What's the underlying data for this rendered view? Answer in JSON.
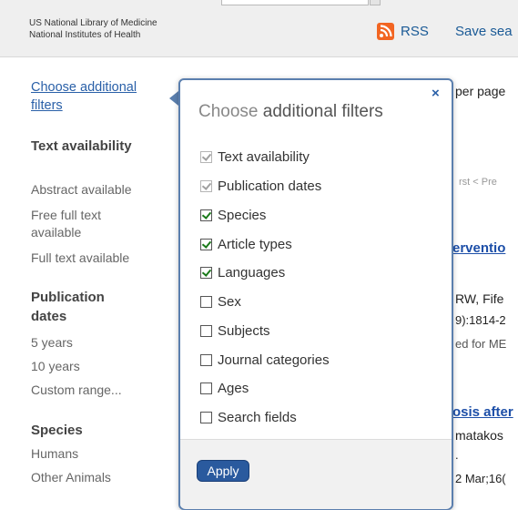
{
  "header": {
    "org_line1": "US National Library of Medicine",
    "org_line2": "National Institutes of Health",
    "rss_label": "RSS",
    "save_label": "Save sea"
  },
  "sidebar": {
    "choose_filters": "Choose additional filters",
    "facets": [
      {
        "title": "Text availability",
        "items": [
          "Abstract available",
          "Free full text available",
          "Full text available"
        ]
      },
      {
        "title": "Publication dates",
        "items": [
          "5 years",
          "10 years",
          "Custom range..."
        ]
      },
      {
        "title": "Species",
        "items": [
          "Humans",
          "Other Animals"
        ]
      }
    ]
  },
  "background": {
    "per_page": "per page",
    "pager": "rst   < Pre",
    "result1_title": "erventio",
    "result1_authors": "RW, Fife",
    "result1_cite": "9):1814-2",
    "result1_note": "ed for ME",
    "result2_title": "osis after",
    "result2_authors": "matakos",
    "result2_dot": ".",
    "result2_cite": "2 Mar;16("
  },
  "popup": {
    "title_light": "Choose ",
    "title_dark": "additional filters",
    "close": "×",
    "options": [
      {
        "label": "Text availability",
        "checked": true,
        "disabled": true
      },
      {
        "label": "Publication dates",
        "checked": true,
        "disabled": true
      },
      {
        "label": "Species",
        "checked": true,
        "disabled": false
      },
      {
        "label": "Article types",
        "checked": true,
        "disabled": false
      },
      {
        "label": "Languages",
        "checked": true,
        "disabled": false
      },
      {
        "label": "Sex",
        "checked": false,
        "disabled": false
      },
      {
        "label": "Subjects",
        "checked": false,
        "disabled": false
      },
      {
        "label": "Journal categories",
        "checked": false,
        "disabled": false
      },
      {
        "label": "Ages",
        "checked": false,
        "disabled": false
      },
      {
        "label": "Search fields",
        "checked": false,
        "disabled": false
      }
    ],
    "apply_label": "Apply"
  },
  "colors": {
    "link": "#2a60a8",
    "popup_border": "#5b7fae",
    "apply_button": "#2a5a9e",
    "rss": "#f26522"
  },
  "icons": [
    "rss-icon",
    "close-icon",
    "checkbox-icon"
  ]
}
